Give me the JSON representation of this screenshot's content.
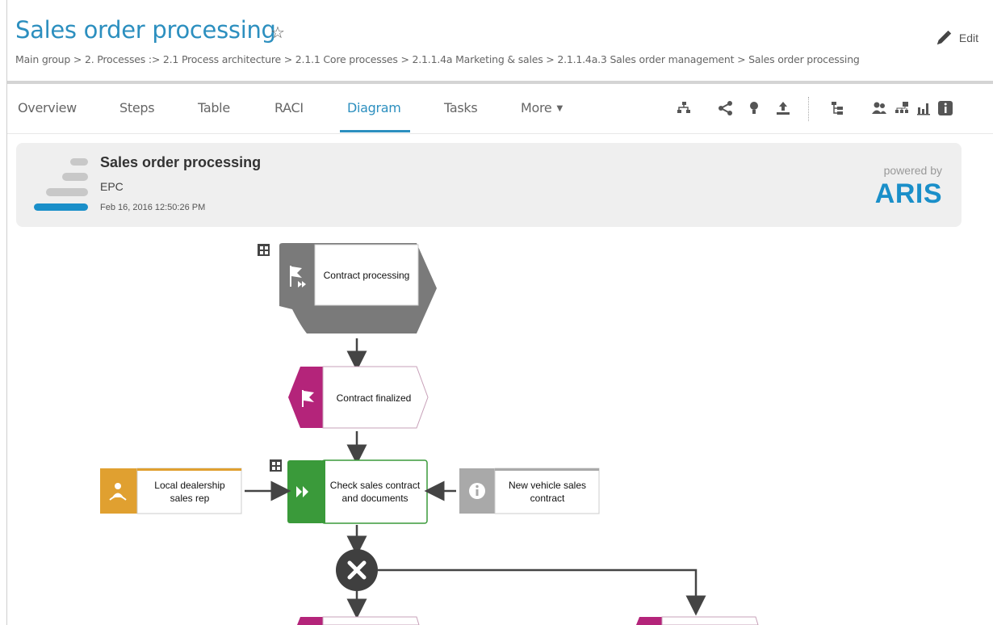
{
  "header": {
    "title": "Sales order processing",
    "edit_label": "Edit",
    "breadcrumb": "Main group > 2. Processes :> 2.1 Process architecture > 2.1.1 Core processes > 2.1.1.4a Marketing & sales > 2.1.1.4a.3 Sales order management > Sales order processing"
  },
  "tabs": [
    {
      "label": "Overview"
    },
    {
      "label": "Steps"
    },
    {
      "label": "Table"
    },
    {
      "label": "RACI"
    },
    {
      "label": "Diagram"
    },
    {
      "label": "Tasks"
    },
    {
      "label": "More"
    }
  ],
  "active_tab": "Diagram",
  "toolbar_icons": [
    "process-flow-icon",
    "share-icon",
    "lightbulb-icon",
    "upload-icon",
    "hierarchy-icon",
    "people-icon",
    "org-chart-icon",
    "bar-chart-icon",
    "info-icon"
  ],
  "model_info": {
    "name": "Sales order processing",
    "type": "EPC",
    "date": "Feb 16, 2016 12:50:26 PM",
    "powered_by": "powered by",
    "brand": "ARIS"
  },
  "diagram": {
    "nodes": {
      "process_interface": "Contract processing",
      "event_finalized": "Contract finalized",
      "function_check": "Check sales contract and documents",
      "role": "Local dealership sales rep",
      "information": "New vehicle sales contract",
      "connector": "XOR"
    }
  },
  "colors": {
    "accent": "#2c8fbf",
    "aris": "#1a8fc9",
    "process_interface": "#7a7a7a",
    "event": "#b4247a",
    "function": "#3a9a3a",
    "role": "#e0a030",
    "information": "#a9a9a9",
    "connector": "#3f3f3f"
  }
}
